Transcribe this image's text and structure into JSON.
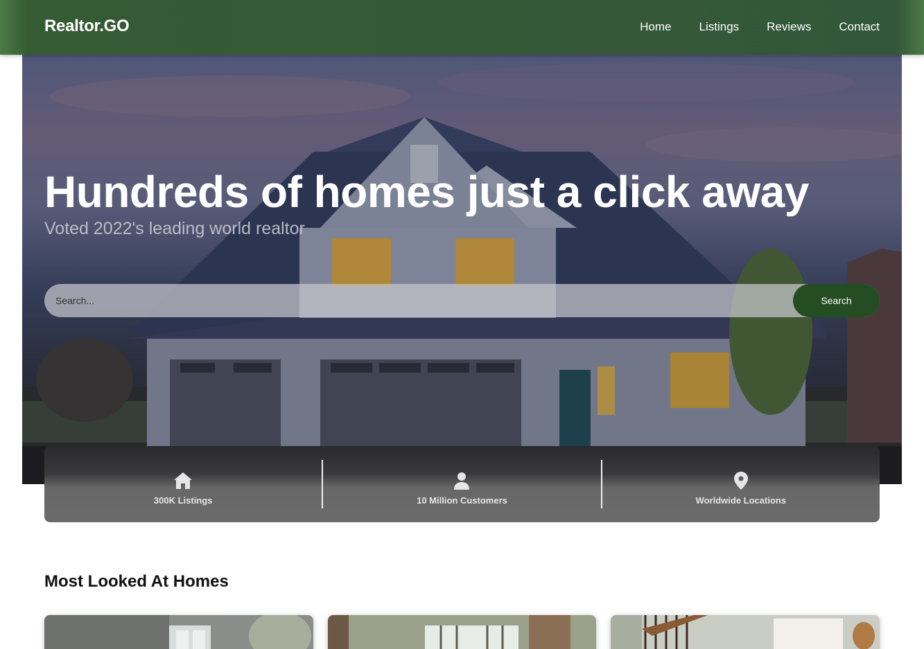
{
  "navbar": {
    "brand": "Realtor.GO",
    "links": [
      "Home",
      "Listings",
      "Reviews",
      "Contact"
    ],
    "background": "#355b34"
  },
  "hero": {
    "title": "Hundreds of homes just a click away",
    "subtitle": "Voted 2022's leading world realtor",
    "search": {
      "placeholder": "Search...",
      "button_label": "Search"
    },
    "accent": "#254d23"
  },
  "stats": [
    {
      "icon": "home-icon",
      "label": "300K Listings"
    },
    {
      "icon": "user-icon",
      "label": "10 Million Customers"
    },
    {
      "icon": "map-pin-icon",
      "label": "Worldwide Locations"
    }
  ],
  "section": {
    "title": "Most Looked At Homes",
    "cards": [
      {
        "image": "living-room-image"
      },
      {
        "image": "dining-room-image"
      },
      {
        "image": "staircase-hall-image"
      }
    ]
  }
}
